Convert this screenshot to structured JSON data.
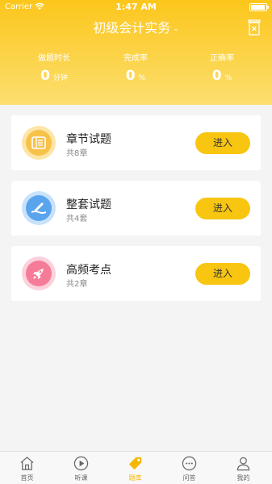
{
  "status_bar": {
    "carrier": "Carrier",
    "time": "1:47 AM"
  },
  "header": {
    "title": "初级会计实务"
  },
  "stats": [
    {
      "label": "做题时长",
      "value": "0",
      "unit": "分钟"
    },
    {
      "label": "完成率",
      "value": "0",
      "unit": "%"
    },
    {
      "label": "正确率",
      "value": "0",
      "unit": "%"
    }
  ],
  "cards": [
    {
      "name": "章节试题",
      "count": "共8章",
      "button": "进入",
      "icon": "chapter-list-icon"
    },
    {
      "name": "整套试题",
      "count": "共4套",
      "button": "进入",
      "icon": "pen-book-icon"
    },
    {
      "name": "高频考点",
      "count": "共2章",
      "button": "进入",
      "icon": "rocket-icon"
    }
  ],
  "tabs": [
    {
      "label": "首页",
      "icon": "home-icon"
    },
    {
      "label": "听课",
      "icon": "play-icon"
    },
    {
      "label": "题库",
      "icon": "tag-icon",
      "active": true
    },
    {
      "label": "问答",
      "icon": "chat-icon"
    },
    {
      "label": "我的",
      "icon": "user-icon"
    }
  ],
  "colors": {
    "accent": "#f8c510",
    "header": "#fcc61b",
    "active_tab": "#f5b800"
  }
}
